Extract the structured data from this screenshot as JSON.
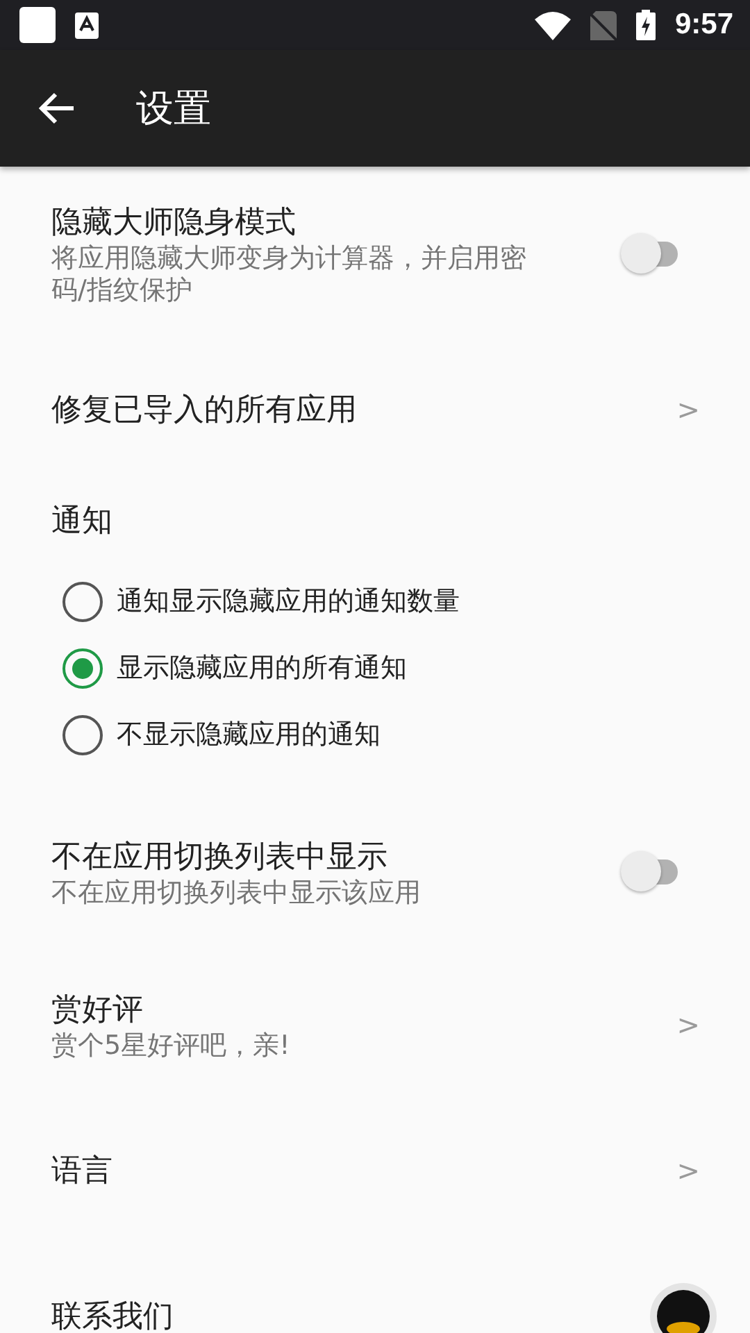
{
  "status_bar": {
    "time": "9:57"
  },
  "app_bar": {
    "title": "设置"
  },
  "items": [
    {
      "kind": "toggle",
      "title": "隐藏大师隐身模式",
      "subtitle": "将应用隐藏大师变身为计算器，并启用密码/指纹保护",
      "on": false
    },
    {
      "kind": "link",
      "title": "修复已导入的所有应用",
      "chevron": ">"
    },
    {
      "kind": "header",
      "title": "通知"
    },
    {
      "kind": "radio",
      "options": [
        {
          "label": "通知显示隐藏应用的通知数量",
          "selected": false
        },
        {
          "label": "显示隐藏应用的所有通知",
          "selected": true
        },
        {
          "label": "不显示隐藏应用的通知",
          "selected": false
        }
      ]
    },
    {
      "kind": "toggle",
      "title": "不在应用切换列表中显示",
      "subtitle": "不在应用切换列表中显示该应用",
      "on": false
    },
    {
      "kind": "link",
      "title": "赏好评",
      "subtitle": "赏个5星好评吧，亲!",
      "chevron": ">"
    },
    {
      "kind": "link",
      "title": "语言",
      "chevron": ">"
    },
    {
      "kind": "contact",
      "title": "联系我们"
    }
  ]
}
